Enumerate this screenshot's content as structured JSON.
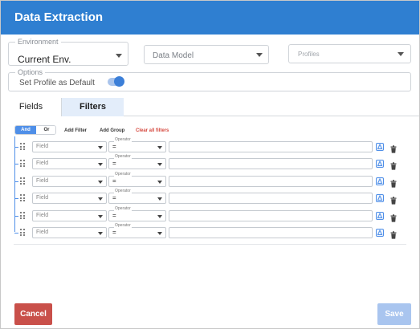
{
  "header": {
    "title": "Data Extraction"
  },
  "environment": {
    "legend": "Environment",
    "value": "Current Env."
  },
  "data_model": {
    "placeholder": "Data Model"
  },
  "profiles": {
    "placeholder": "Profiles"
  },
  "options": {
    "legend": "Options",
    "toggle_label": "Set Profile as Default",
    "toggle_on": true
  },
  "tabs": [
    {
      "label": "Fields",
      "active": false
    },
    {
      "label": "Filters",
      "active": true
    }
  ],
  "filters": {
    "and_label": "And",
    "or_label": "Or",
    "active_conjunction": "And",
    "add_filter": "Add Filter",
    "add_group": "Add Group",
    "clear_all": "Clear all filters",
    "rows": [
      {
        "field_placeholder": "Field",
        "operator_legend": "Operator",
        "operator_value": "=",
        "value": ""
      },
      {
        "field_placeholder": "Field",
        "operator_legend": "Operator",
        "operator_value": "=",
        "value": ""
      },
      {
        "field_placeholder": "Field",
        "operator_legend": "Operator",
        "operator_value": "=",
        "value": ""
      },
      {
        "field_placeholder": "Field",
        "operator_legend": "Operator",
        "operator_value": "=",
        "value": ""
      },
      {
        "field_placeholder": "Field",
        "operator_legend": "Operator",
        "operator_value": "=",
        "value": ""
      },
      {
        "field_placeholder": "Field",
        "operator_legend": "Operator",
        "operator_value": "=",
        "value": ""
      }
    ]
  },
  "footer": {
    "cancel_label": "Cancel",
    "save_label": "Save"
  },
  "colors": {
    "header": "#2f7fd1",
    "accent": "#4f8fe8",
    "danger": "#d5473d",
    "cancel": "#c9504a",
    "save_disabled": "#a9c5ef"
  }
}
